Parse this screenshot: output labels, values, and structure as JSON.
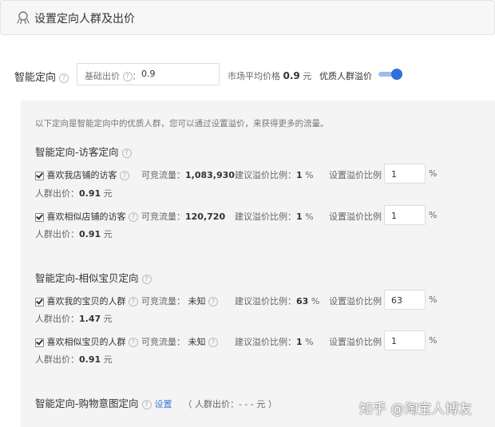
{
  "header": {
    "title": "设置定向人群及出价",
    "icon": "octopus-icon"
  },
  "smart": {
    "label": "智能定向",
    "base_bid_label": "基础出价",
    "base_bid_value": "0.9",
    "market_label": "市场平均价格",
    "market_value": "0.9",
    "market_unit": "元",
    "premium_label": "优质人群溢价",
    "premium_toggle_on": true
  },
  "panel": {
    "intro": "以下定向是智能定向中的优质人群，您可以通过设置溢价，来获得更多的流量。",
    "groups": [
      {
        "title": "智能定向-访客定向",
        "rows": [
          {
            "name": "喜欢我店铺的访客",
            "traffic_label": "可竞流量：",
            "traffic": "1,083,930",
            "suggest_label": "建议溢价比例：",
            "suggest": "1",
            "pct": "%",
            "set_label": "设置溢价比例",
            "set_value": "1",
            "set_pct": "%",
            "bid_label": "人群出价：",
            "bid": "0.91",
            "bid_unit": "元"
          },
          {
            "name": "喜欢相似店铺的访客",
            "traffic_label": "可竞流量：",
            "traffic": "120,720",
            "suggest_label": "建议溢价比例：",
            "suggest": "1",
            "pct": "%",
            "set_label": "设置溢价比例",
            "set_value": "1",
            "set_pct": "%",
            "bid_label": "人群出价：",
            "bid": "0.91",
            "bid_unit": "元"
          }
        ]
      },
      {
        "title": "智能定向-相似宝贝定向",
        "rows": [
          {
            "name": "喜欢我的宝贝的人群",
            "traffic_label": "可竞流量：",
            "traffic": "未知",
            "suggest_label": "建议溢价比例：",
            "suggest": "63",
            "pct": "%",
            "set_label": "设置溢价比例",
            "set_value": "63",
            "set_pct": "%",
            "bid_label": "人群出价：",
            "bid": "1.47",
            "bid_unit": "元"
          },
          {
            "name": "喜欢相似宝贝的人群",
            "traffic_label": "可竞流量：",
            "traffic": "未知",
            "suggest_label": "建议溢价比例：",
            "suggest": "1",
            "pct": "%",
            "set_label": "设置溢价比例",
            "set_value": "1",
            "set_pct": "%",
            "bid_label": "人群出价：",
            "bid": "0.91",
            "bid_unit": "元"
          }
        ]
      }
    ],
    "shopping": {
      "title": "智能定向-购物意图定向",
      "setting_link": "设置",
      "bid_text": "（ 人群出价：- - - 元 ）"
    }
  },
  "watermark": "知乎 @淘宝人博友"
}
